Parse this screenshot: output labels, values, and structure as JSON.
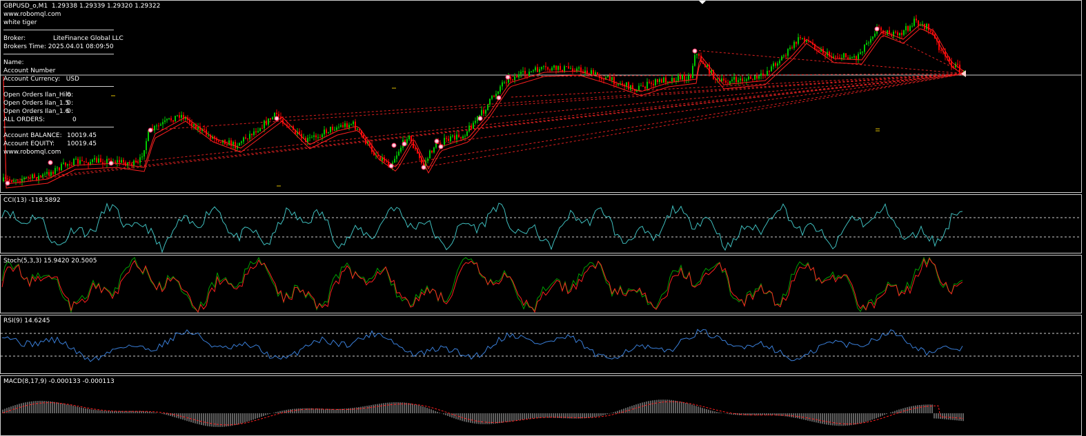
{
  "window": {
    "header": "GBPUSD_o,M1  1.29338 1.29339 1.29320 1.29322",
    "symbol": "GBPUSD_o,M1",
    "ohlc": "1.29338 1.29339 1.29320 1.29322"
  },
  "info_panel": {
    "site_top": "www.robomql.com",
    "ea_name": "white tiger",
    "broker_label": "Broker:",
    "broker_value": "LiteFinance Global LLC",
    "time_label": "Brokers Time:",
    "time_value": "2025.04.01 08:09:50",
    "name_label": "Name:",
    "name_value": "",
    "account_number_label": "Account Number",
    "account_currency_label": "Account Currency:",
    "account_currency_value": "USD",
    "orders": [
      {
        "label": "Open Orders Ilan_Hilo:",
        "value": "0"
      },
      {
        "label": "Open Orders Ilan_1.5 :",
        "value": "0"
      },
      {
        "label": "Open Orders Ilan_1.6 :",
        "value": "0"
      },
      {
        "label": "ALL ORDERS:",
        "value": "0"
      }
    ],
    "balance_label": "Account BALANCE:",
    "balance_value": "10019.45",
    "equity_label": "Account EQUITY:",
    "equity_value": "10019.45",
    "site_bottom": "www.robomql.com"
  },
  "indicators": {
    "cci": "CCI(13) -118.5892",
    "stoch": "Stoch(5,3,3) 15.9420 20.5005",
    "rsi": "RSI(9) 14.6245",
    "macd": "MACD(8,17,9) -0.000133 -0.000113"
  },
  "colors": {
    "bull_candle": "#00c800",
    "bear_candle": "#ff0000",
    "ma": "#ff2020",
    "cci": "#3fbfbf",
    "stoch_main": "#00a000",
    "stoch_signal": "#ff2020",
    "rsi": "#3a7fd9",
    "macd_hist": "#c0c0c0",
    "macd_signal": "#ff2020",
    "grid": "#cfcfcf"
  }
}
